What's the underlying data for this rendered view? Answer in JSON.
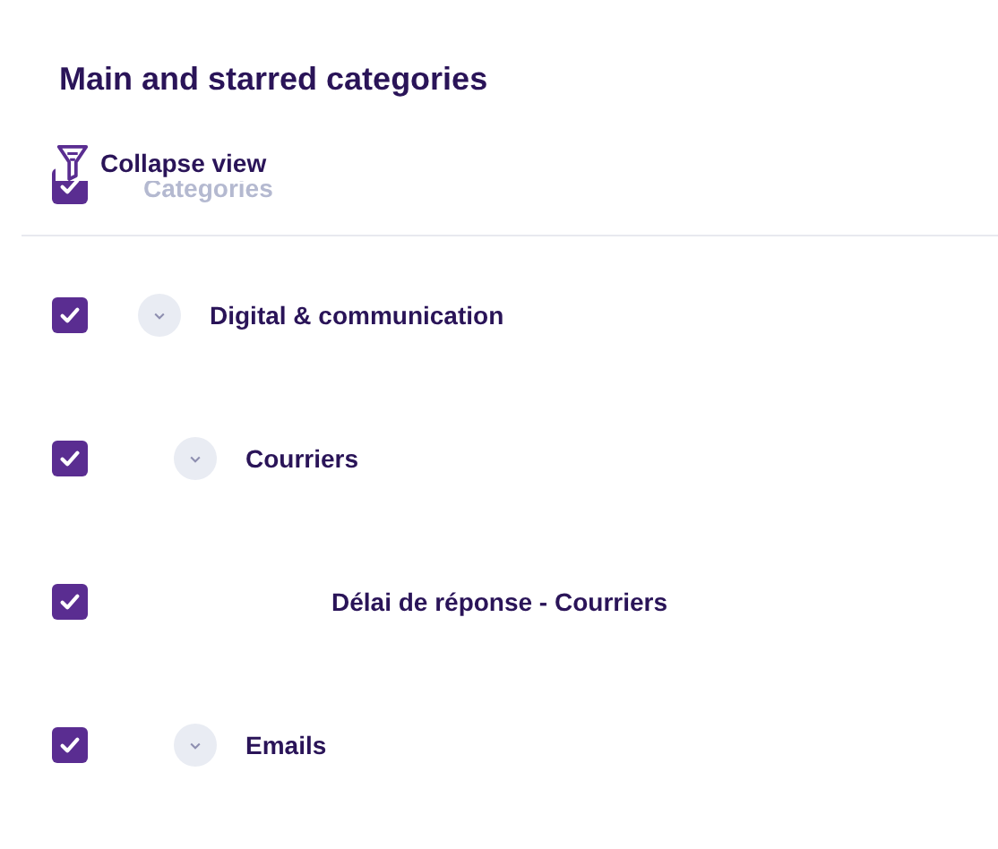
{
  "title": "Main and starred categories",
  "collapse_button": {
    "label": "Collapse view"
  },
  "header": {
    "label": "Categories",
    "checked": true
  },
  "tree": [
    {
      "label": "Digital & communication",
      "checked": true,
      "expanded": true,
      "children": [
        {
          "label": "Courriers",
          "checked": true,
          "expanded": true,
          "children": [
            {
              "label": "Délai de réponse - Courriers",
              "checked": true
            }
          ]
        },
        {
          "label": "Emails",
          "checked": true,
          "expanded": true
        }
      ]
    }
  ]
}
